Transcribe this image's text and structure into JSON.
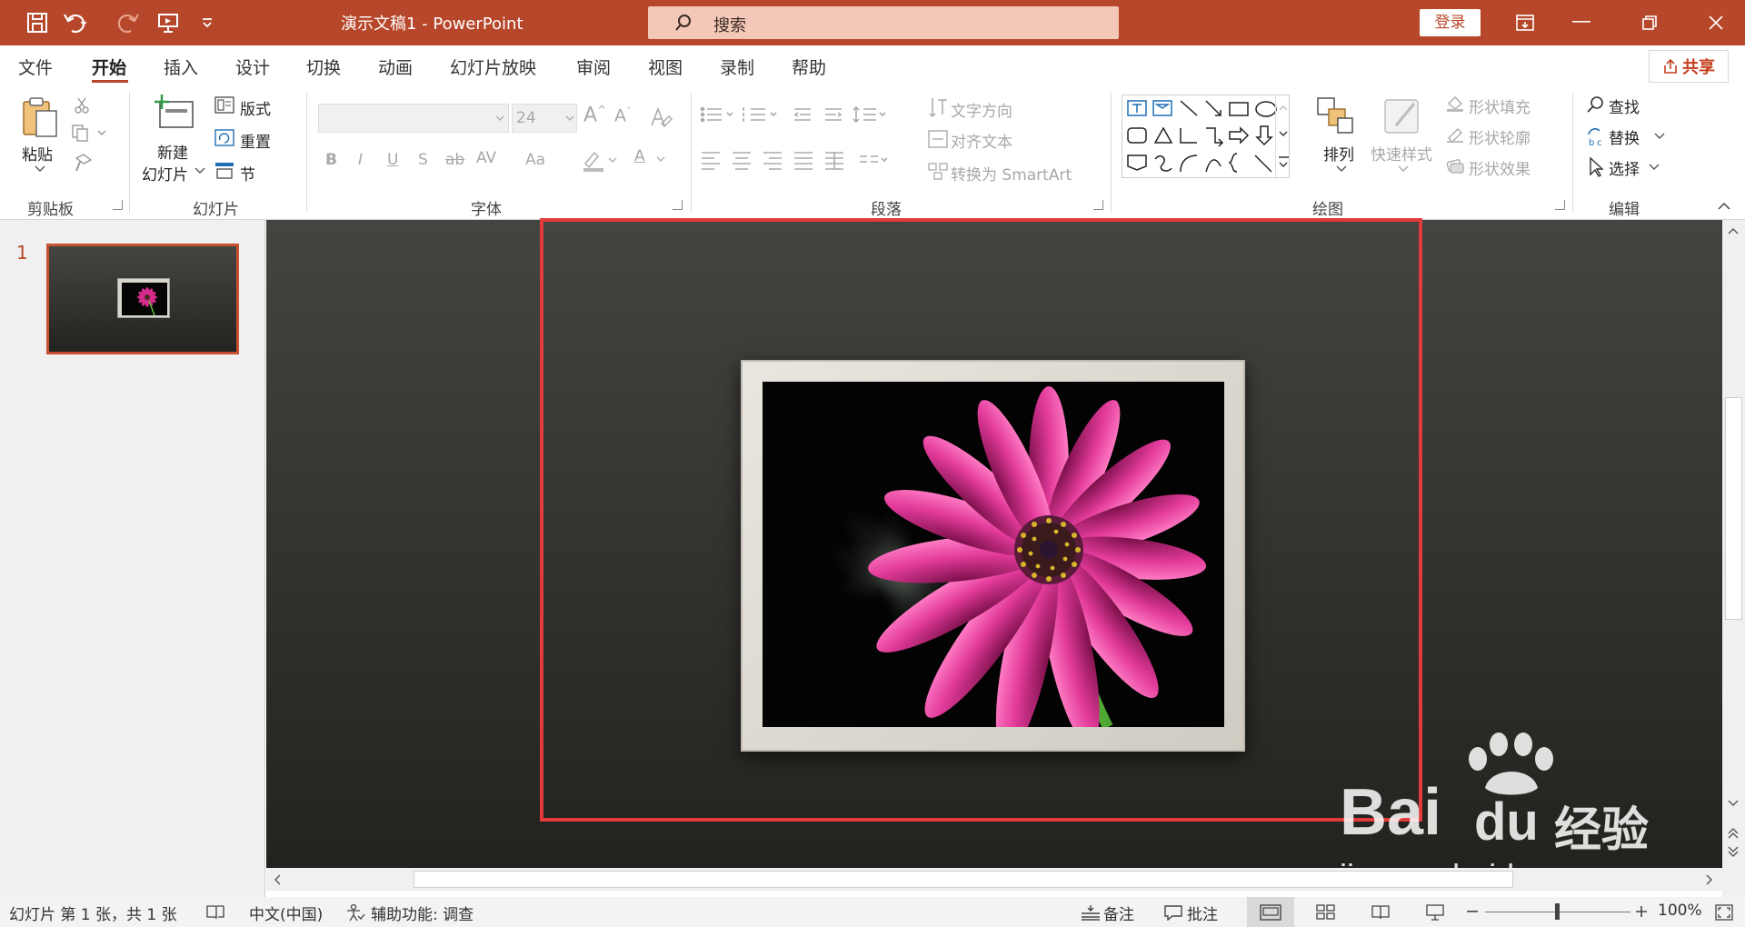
{
  "app": {
    "title": "演示文稿1  -  PowerPoint",
    "search_placeholder": "搜索",
    "login_label": "登录",
    "share_label": "共享",
    "accent": "#b7472a"
  },
  "tabs": [
    {
      "label": "文件"
    },
    {
      "label": "开始"
    },
    {
      "label": "插入"
    },
    {
      "label": "设计"
    },
    {
      "label": "切换"
    },
    {
      "label": "动画"
    },
    {
      "label": "幻灯片放映"
    },
    {
      "label": "审阅"
    },
    {
      "label": "视图"
    },
    {
      "label": "录制"
    },
    {
      "label": "帮助"
    }
  ],
  "ribbon": {
    "clipboard": {
      "paste": "粘贴",
      "label": "剪贴板"
    },
    "slides": {
      "new_slide_line1": "新建",
      "new_slide_line2": "幻灯片",
      "layout": "版式",
      "reset": "重置",
      "section": "节",
      "label": "幻灯片"
    },
    "font": {
      "size": "24",
      "bold": "B",
      "italic": "I",
      "underline": "U",
      "strike": "S",
      "strike2": "ab",
      "spacing": "AV",
      "case": "Aa",
      "font_color": "A",
      "label": "字体"
    },
    "paragraph": {
      "text_direction": "文字方向",
      "align_text": "对齐文本",
      "smartart": "转换为 SmartArt",
      "label": "段落"
    },
    "drawing": {
      "arrange": "排列",
      "quick_styles": "快速样式",
      "shape_fill": "形状填充",
      "shape_outline": "形状轮廓",
      "shape_effects": "形状效果",
      "label": "绘图"
    },
    "editing": {
      "find": "查找",
      "replace": "替换",
      "select": "选择",
      "label": "编辑"
    }
  },
  "thumbnails": {
    "slide_number": "1"
  },
  "status": {
    "slide_info": "幻灯片 第 1 张，共 1 张",
    "language": "中文(中国)",
    "accessibility": "辅助功能: 调查",
    "notes": "备注",
    "comments": "批注",
    "zoom": "100%",
    "zoom_fraction": 0.5
  },
  "watermark": {
    "brand": "Bai",
    "brand2": "du",
    "product": "经验",
    "url": "jingyan.baidu.com"
  }
}
